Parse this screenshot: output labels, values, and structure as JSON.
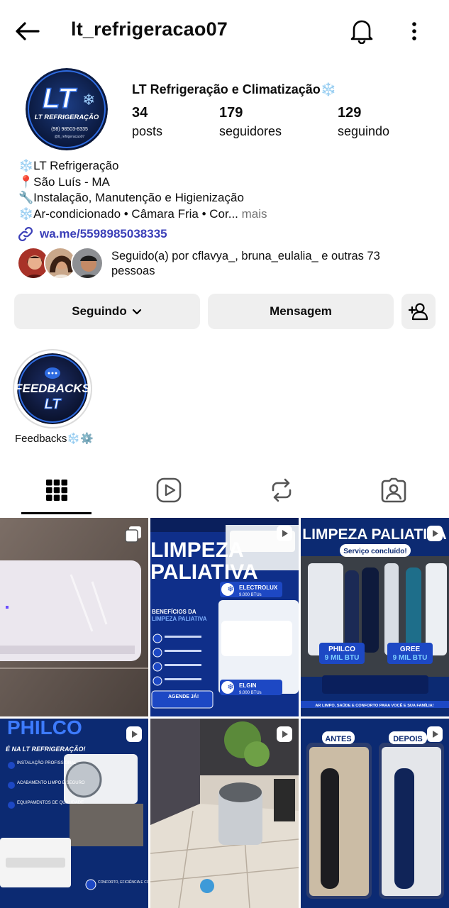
{
  "header": {
    "username": "lt_refrigeracao07",
    "back_icon": "arrow-left-icon",
    "bell_icon": "bell-icon",
    "more_icon": "more-vertical-icon"
  },
  "profile": {
    "display_name": "LT Refrigeração e Climatização❄️",
    "avatar_brand": "LT",
    "avatar_caption": "LT REFRIGERAÇÃO",
    "avatar_phone": "(98) 98503-8335",
    "avatar_handle": "@lt_refrigeracao07",
    "stats": [
      {
        "value": "34",
        "label": "posts"
      },
      {
        "value": "179",
        "label": "seguidores"
      },
      {
        "value": "129",
        "label": "seguindo"
      }
    ]
  },
  "bio": {
    "lines": [
      "❄️LT Refrigeração",
      "📍São Luís - MA",
      "🔧Instalação, Manutenção e Higienização",
      "❄️Ar-condicionado • Câmara Fria • Cor..."
    ],
    "more": " mais",
    "link": "wa.me/5598985038335"
  },
  "followed_by": {
    "text": "Seguido(a) por cflavya_, bruna_eulalia_ e outras 73 pessoas"
  },
  "actions": {
    "following": "Seguindo",
    "message": "Mensagem",
    "add_user_icon": "add-person-icon"
  },
  "highlights": [
    {
      "label": "Feedbacks❄️⚙️",
      "cover_title": "FEEDBACKS",
      "cover_brand": "LT"
    }
  ],
  "tabs": [
    {
      "icon": "grid-icon",
      "active": true
    },
    {
      "icon": "reels-icon",
      "active": false
    },
    {
      "icon": "reposts-icon",
      "active": false
    },
    {
      "icon": "tagged-icon",
      "active": false
    }
  ],
  "posts": [
    {
      "type": "carousel",
      "lines": []
    },
    {
      "type": "reel",
      "lines": [
        "LIMPEZA",
        "PALIATIVA",
        "ELECTROLUX",
        "9.000 BTUs",
        "BENEFÍCIOS DA",
        "LIMPEZA PALIATIVA",
        "ELGIN",
        "9.000 BTUs",
        "AGENDE JÁ!"
      ]
    },
    {
      "type": "reel",
      "lines": [
        "LIMPEZA PALIATIVA",
        "Serviço concluído!",
        "PHILCO",
        "9 MIL BTU",
        "GREE",
        "9 MIL BTU",
        "AR LIMPO, SAÚDE E CONFORTO PARA VOCÊ E SUA FAMÍLIA!"
      ]
    },
    {
      "type": "reel",
      "lines": [
        "PHILCO",
        "É NA LT REFRIGERAÇÃO!",
        "INSTALAÇÃO PROFISSIONAL",
        "ACABAMENTO LIMPO E SEGURO",
        "EQUIPAMENTOS DE QUALIDADE",
        "CONFORTO, EFICIÊNCIA E CONFIANÇA PARA VOCÊ!"
      ]
    },
    {
      "type": "reel",
      "lines": []
    },
    {
      "type": "reel",
      "lines": [
        "ANTES",
        "DEPOIS"
      ]
    }
  ],
  "colors": {
    "link": "#3b3fb8",
    "button_bg": "#efefef",
    "brand_blue": "#1a56c8",
    "brand_navy": "#0b1f4a"
  }
}
